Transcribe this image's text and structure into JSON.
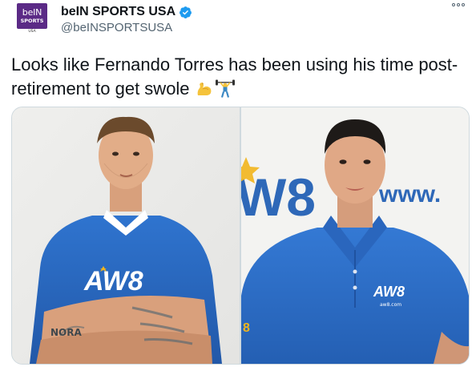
{
  "tweet": {
    "avatar": {
      "brand_top": "beIN",
      "brand_middle": "SPORTS",
      "brand_bottom": "USA"
    },
    "display_name": "beIN SPORTS USA",
    "handle": "@beINSPORTSUSA",
    "verified": true,
    "text": "Looks like Fernando Torres has been using his time post-retirement to get swole",
    "emojis": [
      "flexed-biceps-emoji",
      "weight-lifter-emoji"
    ],
    "more_icon": "ellipsis-icon"
  },
  "media": {
    "photos": [
      {
        "name": "photo-left",
        "shirt_logo": "AW8",
        "tattoo_text": "NORA"
      },
      {
        "name": "photo-right",
        "background_text": "www.",
        "background_logo": "W8",
        "shirt_logo": "AW8",
        "shirt_sub": "aw8.com",
        "sleeve_text": "8"
      }
    ]
  },
  "colors": {
    "brand_purple": "#5b2a86",
    "verified_blue": "#1d9bf0",
    "shirt_blue": "#2b6cc4",
    "logo_yellow": "#f2b51c"
  }
}
